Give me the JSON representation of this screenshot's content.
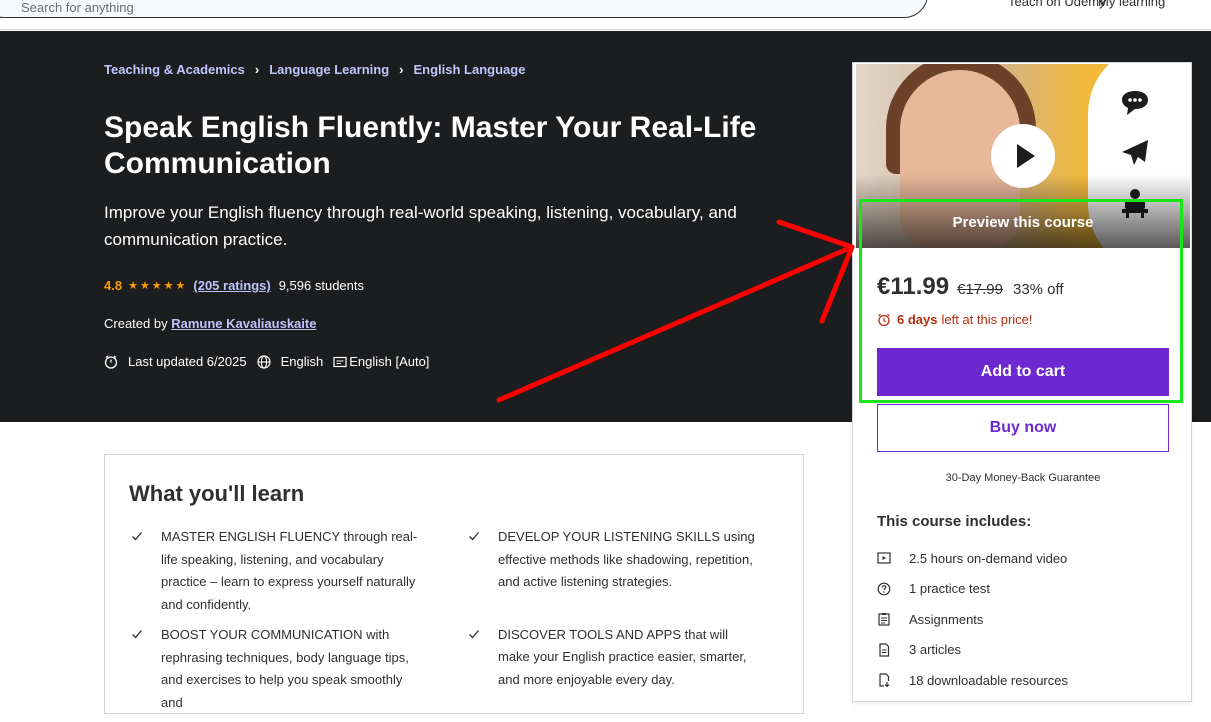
{
  "topbar": {
    "search_placeholder": "Search for anything",
    "nav_items": [
      "Teach on Udemy",
      "My learning"
    ]
  },
  "breadcrumb": [
    "Teaching & Academics",
    "Language Learning",
    "English Language"
  ],
  "course": {
    "title": "Speak English Fluently: Master Your Real-Life Communication",
    "subtitle": "Improve your English fluency through real-world speaking, listening, vocabulary, and communication practice.",
    "rating": "4.8",
    "stars": "★★★★★",
    "ratings_count": "(205 ratings)",
    "students": "9,596 students",
    "created_by_label": "Created by",
    "instructor": "Ramune Kavaliauskaite",
    "last_updated": "Last updated 6/2025",
    "language": "English",
    "captions": "English [Auto]"
  },
  "card": {
    "preview_label": "Preview this course",
    "price": "€11.99",
    "old_price": "€17.99",
    "discount": "33% off",
    "timer_days": "6 days",
    "timer_rest": "left at this price!",
    "add_to_cart": "Add to cart",
    "buy_now": "Buy now",
    "guarantee": "30-Day Money-Back Guarantee",
    "includes_title": "This course includes:",
    "includes": [
      {
        "icon": "video-icon",
        "label": "2.5 hours on-demand video"
      },
      {
        "icon": "question-icon",
        "label": "1 practice test"
      },
      {
        "icon": "assignment-icon",
        "label": "Assignments"
      },
      {
        "icon": "article-icon",
        "label": "3 articles"
      },
      {
        "icon": "download-icon",
        "label": "18 downloadable resources"
      }
    ]
  },
  "learn": {
    "title": "What you'll learn",
    "left": [
      "MASTER ENGLISH FLUENCY through real-life speaking, listening, and vocabulary practice – learn to express yourself naturally and confidently.",
      "BOOST YOUR COMMUNICATION with rephrasing techniques, body language tips, and exercises to help you speak smoothly and"
    ],
    "right": [
      "DEVELOP YOUR LISTENING SKILLS using effective methods like shadowing, repetition, and active listening strategies.",
      "DISCOVER TOOLS AND APPS that will make your English practice easier, smarter, and more enjoyable every day."
    ]
  },
  "colors": {
    "hero_bg": "#1c1d1f",
    "accent_purple": "#6d28d2",
    "link_lavender": "#c0c4fc",
    "star_orange": "#f69c08",
    "timer_red": "#b32d0f",
    "highlight_green": "#19e619",
    "arrow_red": "#ff0000"
  }
}
